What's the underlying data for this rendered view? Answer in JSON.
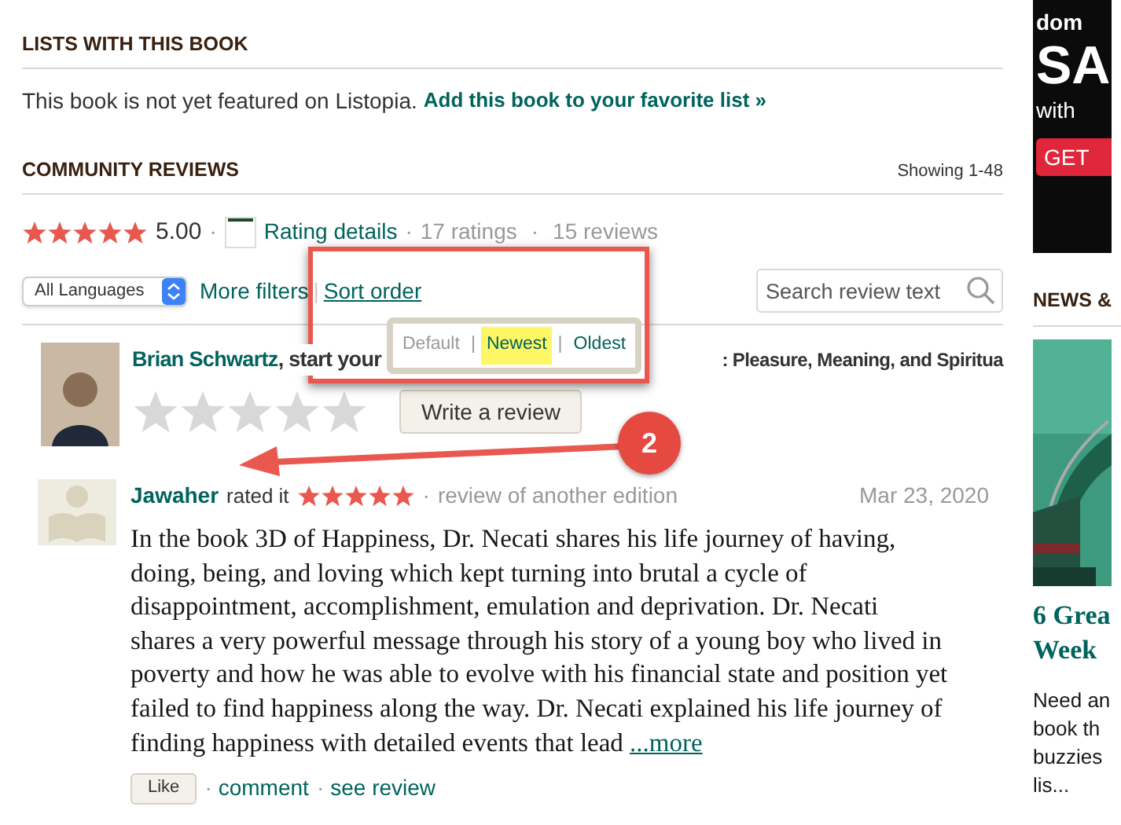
{
  "lists": {
    "heading": "LISTS WITH THIS BOOK",
    "text": "This book is not yet featured on Listopia.",
    "link": "Add this book to your favorite list »"
  },
  "community": {
    "heading": "COMMUNITY REVIEWS",
    "showing": "Showing 1-48",
    "rating": {
      "stars": 5,
      "value": "5.00",
      "details": "Rating details",
      "ratings": "17 ratings",
      "reviews": "15 reviews",
      "separators": [
        "·",
        "·",
        "·"
      ]
    },
    "filters": {
      "language": "All Languages",
      "more": "More filters",
      "separator": "|",
      "sort": "Sort order",
      "search": {
        "placeholder": "Search review text"
      }
    }
  },
  "sort_popup": {
    "separators": [
      "|",
      "|"
    ],
    "options": [
      {
        "label": "Default",
        "selected": false,
        "disabled": true
      },
      {
        "label": "Newest",
        "selected": true,
        "disabled": false
      },
      {
        "label": "Oldest",
        "selected": false,
        "disabled": false
      }
    ]
  },
  "my_row": {
    "name": "Brian Schwartz",
    "text": ", start your",
    "text_2": ": Pleasure, Meaning, and Spiritua",
    "stars": 0,
    "button": "Write a review"
  },
  "review": {
    "name": "Jawaher",
    "action": "rated it",
    "stars": 5,
    "separator": "·",
    "link_separators": [
      "·",
      "·"
    ],
    "meta": "review of another edition",
    "date": "Mar 23, 2020",
    "body": "In the book 3D of Happiness, Dr. Necati shares his life journey of having, doing, being, and loving which kept turning into brutal a cycle of disappointment, accomplishment, emulation and deprivation. Dr. Necati shares a very powerful message through his story of a young boy who lived in poverty and how he was able to evolve with his financial state and position yet failed to find happiness along the way. Dr. Necati explained his life journey of finding happiness with detailed events that lead",
    "more": "...more",
    "like": "Like",
    "links": [
      "comment",
      "see review"
    ]
  },
  "annotation": {
    "badge": "2"
  },
  "sidebar": {
    "ad_lines": [
      "dom",
      "SA",
      "with"
    ],
    "ad_button": "GET",
    "news_heading": "NEWS &",
    "article_title": [
      "6 Grea",
      "Week"
    ],
    "teaser": [
      "Need an",
      "book th",
      "buzzies",
      "lis..."
    ]
  }
}
